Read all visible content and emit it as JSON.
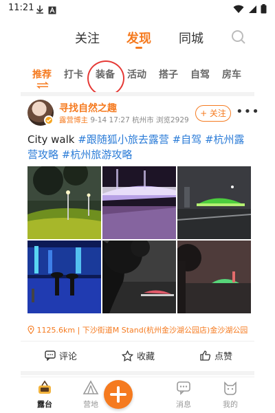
{
  "status_bar": {
    "time": "11:21"
  },
  "top_nav": {
    "tabs": [
      "关注",
      "发现",
      "同城"
    ],
    "active_index": 1
  },
  "categories": {
    "items": [
      "推荐",
      "打卡",
      "装备",
      "活动",
      "搭子",
      "自驾",
      "房车"
    ],
    "active_index": 0
  },
  "post": {
    "author": "寻找自然之趣",
    "role": "露营博主",
    "date": "9-14 17:27",
    "city": "杭州市",
    "views": "浏览2929",
    "follow_label": "+ 关注",
    "more_label": "•••",
    "text_plain": "City walk ",
    "tags": [
      "#跟随狐小旅去露营",
      "#自驾",
      "#杭州露营攻略",
      "#杭州旅游攻略"
    ],
    "location": "1125.6km | 下沙街道M Stand(杭州金沙湖公园店)金沙湖公园"
  },
  "actions": {
    "comment": "评论",
    "favorite": "收藏",
    "like": "点赞"
  },
  "bottom_nav": {
    "items": [
      "露台",
      "营地",
      "",
      "消息",
      "我的"
    ],
    "active_index": 0
  },
  "colors": {
    "accent": "#f57a1f",
    "tag": "#2a7bd7",
    "annotation": "#e53935"
  }
}
